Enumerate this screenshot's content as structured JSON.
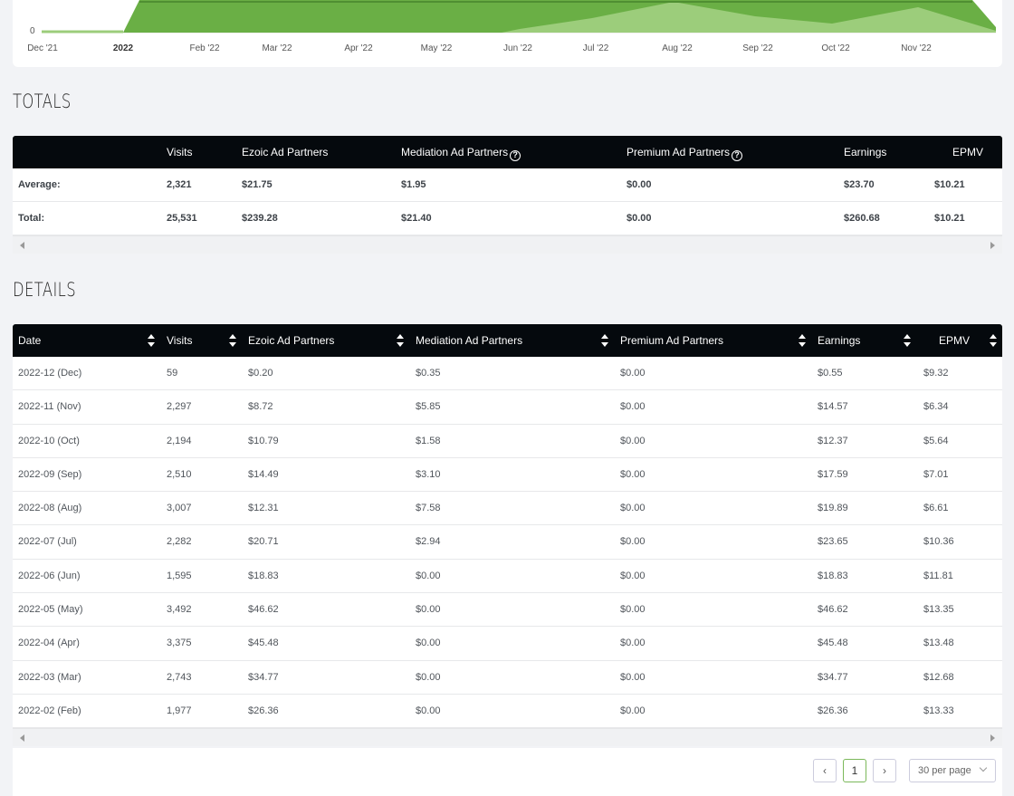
{
  "chart": {
    "y_zero_label": "0",
    "x_labels": [
      "Dec '21",
      "2022",
      "Feb '22",
      "Mar '22",
      "Apr '22",
      "May '22",
      "Jun '22",
      "Jul '22",
      "Aug '22",
      "Sep '22",
      "Oct '22",
      "Nov '22"
    ],
    "fill_color": "#6aaf45",
    "light_fill_color": "#9ccd7b"
  },
  "totals": {
    "title": "TOTALS",
    "headers": [
      "Visits",
      "Ezoic Ad Partners",
      "Mediation Ad Partners",
      "Premium Ad Partners",
      "Earnings",
      "EPMV"
    ],
    "rows": [
      {
        "label": "Average:",
        "values": [
          "2,321",
          "$21.75",
          "$1.95",
          "$0.00",
          "$23.70",
          "$10.21"
        ]
      },
      {
        "label": "Total:",
        "values": [
          "25,531",
          "$239.28",
          "$21.40",
          "$0.00",
          "$260.68",
          "$10.21"
        ]
      }
    ]
  },
  "details": {
    "title": "DETAILS",
    "headers": [
      "Date",
      "Visits",
      "Ezoic Ad Partners",
      "Mediation Ad Partners",
      "Premium Ad Partners",
      "Earnings",
      "EPMV"
    ],
    "rows": [
      [
        "2022-12 (Dec)",
        "59",
        "$0.20",
        "$0.35",
        "$0.00",
        "$0.55",
        "$9.32"
      ],
      [
        "2022-11 (Nov)",
        "2,297",
        "$8.72",
        "$5.85",
        "$0.00",
        "$14.57",
        "$6.34"
      ],
      [
        "2022-10 (Oct)",
        "2,194",
        "$10.79",
        "$1.58",
        "$0.00",
        "$12.37",
        "$5.64"
      ],
      [
        "2022-09 (Sep)",
        "2,510",
        "$14.49",
        "$3.10",
        "$0.00",
        "$17.59",
        "$7.01"
      ],
      [
        "2022-08 (Aug)",
        "3,007",
        "$12.31",
        "$7.58",
        "$0.00",
        "$19.89",
        "$6.61"
      ],
      [
        "2022-07 (Jul)",
        "2,282",
        "$20.71",
        "$2.94",
        "$0.00",
        "$23.65",
        "$10.36"
      ],
      [
        "2022-06 (Jun)",
        "1,595",
        "$18.83",
        "$0.00",
        "$0.00",
        "$18.83",
        "$11.81"
      ],
      [
        "2022-05 (May)",
        "3,492",
        "$46.62",
        "$0.00",
        "$0.00",
        "$46.62",
        "$13.35"
      ],
      [
        "2022-04 (Apr)",
        "3,375",
        "$45.48",
        "$0.00",
        "$0.00",
        "$45.48",
        "$13.48"
      ],
      [
        "2022-03 (Mar)",
        "2,743",
        "$34.77",
        "$0.00",
        "$0.00",
        "$34.77",
        "$12.68"
      ],
      [
        "2022-02 (Feb)",
        "1,977",
        "$26.36",
        "$0.00",
        "$0.00",
        "$26.36",
        "$13.33"
      ]
    ]
  },
  "pagination": {
    "prev": "‹",
    "current_page": "1",
    "next": "›",
    "per_page": "30 per page"
  }
}
